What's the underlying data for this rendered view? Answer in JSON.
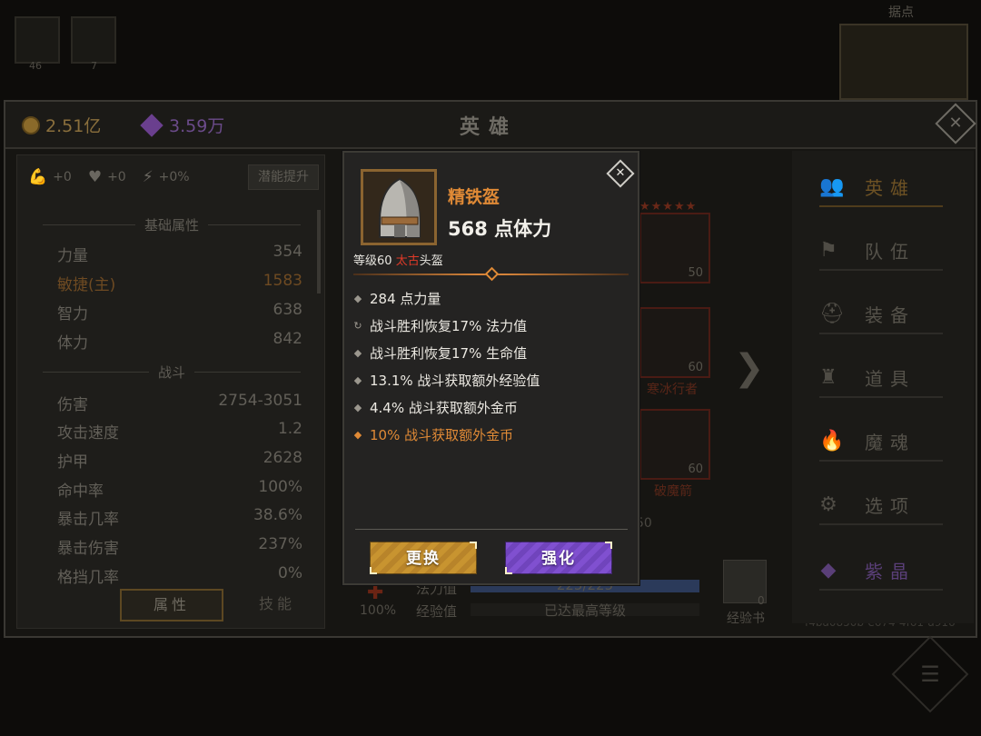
{
  "background": {
    "slot_counts": [
      "46",
      "7"
    ],
    "map_label": "据点"
  },
  "header": {
    "gold": "2.51亿",
    "gems": "3.59万",
    "title": "英雄"
  },
  "bonuses": [
    {
      "icon": "strength-arm-icon",
      "value": "+0"
    },
    {
      "icon": "heart-icon",
      "value": "+0"
    },
    {
      "icon": "lightning-icon",
      "value": "+0%"
    }
  ],
  "potential_button": "潜能提升",
  "sections": {
    "basic": "基础属性",
    "combat": "战斗"
  },
  "basic_stats": [
    {
      "label": "力量",
      "value": "354"
    },
    {
      "label": "敏捷(主)",
      "value": "1583"
    },
    {
      "label": "智力",
      "value": "638"
    },
    {
      "label": "体力",
      "value": "842"
    }
  ],
  "combat_stats": [
    {
      "label": "伤害",
      "value": "2754-3051"
    },
    {
      "label": "攻击速度",
      "value": "1.2"
    },
    {
      "label": "护甲",
      "value": "2628"
    },
    {
      "label": "命中率",
      "value": "100%"
    },
    {
      "label": "暴击几率",
      "value": "38.6%"
    },
    {
      "label": "暴击伤害",
      "value": "237%"
    },
    {
      "label": "格挡几率",
      "value": "0%"
    }
  ],
  "tabs": {
    "attributes": "属性",
    "skills": "技能"
  },
  "hero": {
    "stars": "★★★★★",
    "slots": [
      {
        "level": "50",
        "name": ""
      },
      {
        "level": "60",
        "name": "寒冰行者"
      },
      {
        "level": "60",
        "name": "破魔箭"
      }
    ],
    "num_50": "50",
    "mana_label": "法力值",
    "mana_value": "225/225",
    "mana_fill": 1.0,
    "exp_label": "经验值",
    "exp_value": "已达最高等级",
    "percent": "100%",
    "exp_book_label": "经验书",
    "exp_book_count": "0",
    "uuid": "f4ba0850b-e674-4f61-a916"
  },
  "nav": [
    {
      "label": "英雄",
      "icon": "hero-icon"
    },
    {
      "label": "队伍",
      "icon": "flag-icon"
    },
    {
      "label": "装备",
      "icon": "helmet-icon"
    },
    {
      "label": "道具",
      "icon": "bag-icon"
    },
    {
      "label": "魔魂",
      "icon": "flame-icon"
    },
    {
      "label": "选项",
      "icon": "gear-icon"
    },
    {
      "label": "紫晶",
      "icon": "crystal-icon"
    }
  ],
  "popup": {
    "item_name": "精铁盔",
    "main_stat": "568 点体力",
    "level_text": "等级60 ",
    "quality": "太古",
    "item_type": "头盔",
    "affixes": [
      {
        "bullet": "◆",
        "text": "284 点力量"
      },
      {
        "bullet": "↻",
        "text": "战斗胜利恢复17% 法力值"
      },
      {
        "bullet": "◆",
        "text": "战斗胜利恢复17% 生命值"
      },
      {
        "bullet": "◆",
        "text": "13.1% 战斗获取额外经验值"
      },
      {
        "bullet": "◆",
        "text": "4.4% 战斗获取额外金币"
      },
      {
        "bullet": "◆",
        "text": "10% 战斗获取额外金币"
      }
    ],
    "replace_button": "更换",
    "enhance_button": "强化"
  },
  "colors": {
    "item_name": "#e08a36",
    "quality_red": "#e03a28",
    "replace_gold": "#c89430",
    "enhance_purple": "#8050d0"
  }
}
